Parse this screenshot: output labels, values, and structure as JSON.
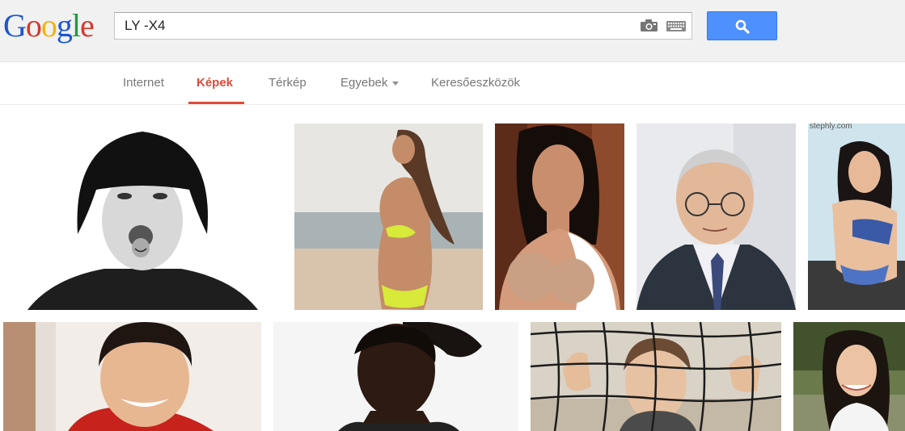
{
  "logo": {
    "letters": [
      "G",
      "o",
      "o",
      "g",
      "l",
      "e"
    ]
  },
  "search": {
    "query": "LY -X4"
  },
  "tabs": [
    {
      "label": "Internet"
    },
    {
      "label": "Képek"
    },
    {
      "label": "Térkép"
    },
    {
      "label": "Egyebek"
    },
    {
      "label": "Keresőeszközök"
    }
  ],
  "colors": {
    "accent": "#dd4b39",
    "search_button": "#4d90fe",
    "logo_blue": "#1a55d6",
    "logo_red": "#d9372b",
    "logo_yellow": "#f2b20a",
    "logo_green": "#1f9a3c"
  },
  "results": {
    "row1": [
      {
        "subject": "woman with black bob haircut, tongue out"
      },
      {
        "subject": "woman in yellow bikini on beach"
      },
      {
        "subject": "woman in white top"
      },
      {
        "subject": "older man with glasses in suit"
      },
      {
        "subject": "woman in blue lingerie",
        "source": "stephly.com"
      }
    ],
    "row2": [
      {
        "subject": "smiling young man in red"
      },
      {
        "subject": "woman with curly hair bun"
      },
      {
        "subject": "woman behind volleyball net"
      },
      {
        "subject": "smiling woman outdoors"
      }
    ]
  }
}
